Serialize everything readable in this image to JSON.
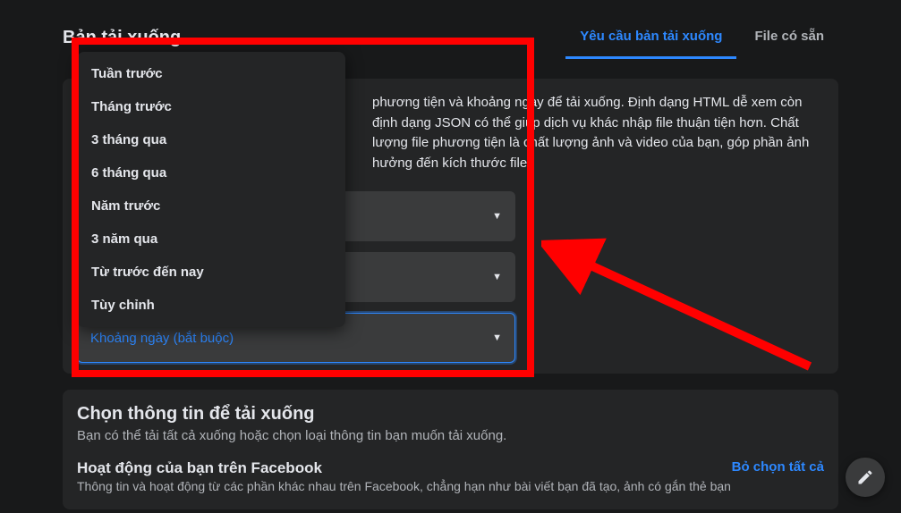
{
  "header": {
    "title": "Bản tải xuống"
  },
  "tabs": {
    "request": "Yêu cầu bản tải xuống",
    "available": "File có sẵn"
  },
  "card1": {
    "desc": "phương tiện và khoảng ngày để tải xuống. Định dạng HTML dễ xem còn định dạng JSON có thể giúp dịch vụ khác nhập file thuận tiện hơn. Chất lượng file phương tiện là chất lượng ảnh và video của bạn, góp phần ảnh hưởng đến kích thước file.",
    "date_range_label": "Khoảng ngày (bắt buộc)"
  },
  "dropdown": {
    "items": [
      "Tuần trước",
      "Tháng trước",
      "3 tháng qua",
      "6 tháng qua",
      "Năm trước",
      "3 năm qua",
      "Từ trước đến nay",
      "Tùy chỉnh"
    ]
  },
  "section2": {
    "title": "Chọn thông tin để tải xuống",
    "desc": "Bạn có thể tải tất cả xuống hoặc chọn loại thông tin bạn muốn tải xuống.",
    "activity_title": "Hoạt động của bạn trên Facebook",
    "activity_desc": "Thông tin và hoạt động từ các phần khác nhau trên Facebook, chẳng hạn như bài viết bạn đã tạo, ảnh có gắn thẻ bạn",
    "deselect": "Bỏ chọn tất cả"
  }
}
